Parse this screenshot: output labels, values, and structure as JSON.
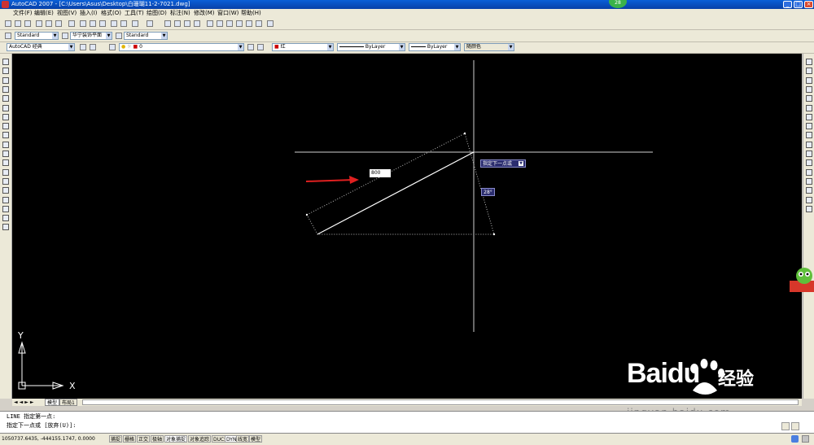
{
  "window": {
    "title": "AutoCAD 2007 - [C:\\Users\\Asus\\Desktop\\白珊瑚11-2-7021.dwg]",
    "badge": "28"
  },
  "menu": [
    "文件(F)",
    "编辑(E)",
    "视图(V)",
    "插入(I)",
    "格式(O)",
    "工具(T)",
    "绘图(D)",
    "标注(N)",
    "修改(M)",
    "窗口(W)",
    "帮助(H)"
  ],
  "styles": {
    "text_style": "Standard",
    "dim_style": "华宁装饰平面",
    "table_style": "Standard"
  },
  "properties": {
    "workspace": "AutoCAD 经典",
    "layer": "0",
    "color": "红",
    "linetype": "ByLayer",
    "lineweight": "ByLayer",
    "plotstyle": "随颜色"
  },
  "drawing": {
    "dynamic_input_value": "800",
    "prompt_tooltip": "指定下一点或",
    "angle_label": "28°",
    "ucs_y": "Y",
    "ucs_x": "X"
  },
  "layout_tabs": [
    "模型",
    "布局1"
  ],
  "command_history": [
    "LINE 指定第一点:",
    "指定下一点或 [放弃(U)]:"
  ],
  "status": {
    "coords": "1050737.6435, -444155.1747, 0.0000",
    "toggles": [
      "捕捉",
      "栅格",
      "正交",
      "极轴",
      "对象捕捉",
      "对象追踪",
      "DUCS",
      "DYN",
      "线宽",
      "模型"
    ]
  },
  "watermark": {
    "brand": "Baidu",
    "chinese": "经验",
    "url": "jingyan.baidu.com"
  },
  "colors": {
    "canvas": "#000000",
    "arrow": "#e02020",
    "tooltip_bg": "#2b2d6e",
    "line": "#ffffff"
  },
  "icons": {
    "left_toolbar": [
      "line-icon",
      "construction-line-icon",
      "polyline-icon",
      "polygon-icon",
      "rectangle-icon",
      "arc-icon",
      "circle-icon",
      "revision-cloud-icon",
      "spline-icon",
      "ellipse-icon",
      "ellipse-arc-icon",
      "insert-block-icon",
      "make-block-icon",
      "point-icon",
      "hatch-icon",
      "gradient-icon",
      "region-icon",
      "table-icon",
      "multiline-text-icon"
    ],
    "right_toolbar": [
      "erase-icon",
      "copy-icon",
      "mirror-icon",
      "offset-icon",
      "array-icon",
      "move-icon",
      "rotate-icon",
      "scale-icon",
      "stretch-icon",
      "trim-icon",
      "extend-icon",
      "break-at-point-icon",
      "break-icon",
      "join-icon",
      "chamfer-icon",
      "fillet-icon",
      "explode-icon"
    ]
  }
}
